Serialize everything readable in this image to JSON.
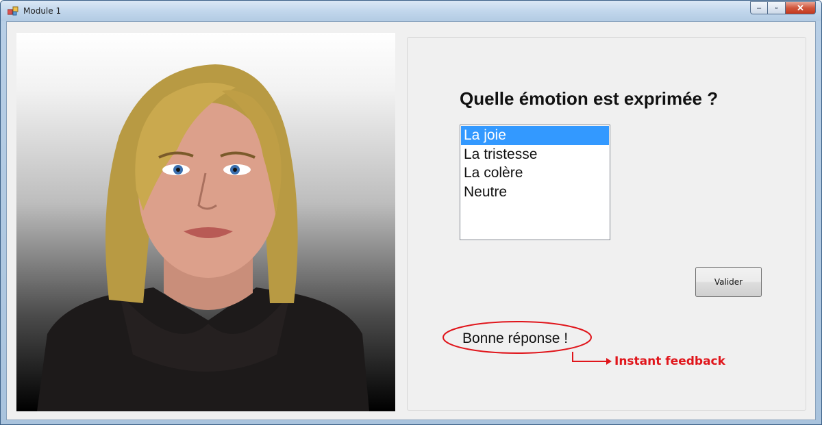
{
  "window": {
    "title": "Module 1",
    "minimize_glyph": "–",
    "maximize_glyph": "▫",
    "close_glyph": "✕"
  },
  "avatar": {
    "icon": "avatar-3d-face",
    "description_visible": false
  },
  "quiz": {
    "question": "Quelle émotion est exprimée ?",
    "options": [
      {
        "label": "La joie",
        "selected": true
      },
      {
        "label": "La tristesse",
        "selected": false
      },
      {
        "label": "La colère",
        "selected": false
      },
      {
        "label": "Neutre",
        "selected": false
      }
    ],
    "submit_label": "Valider",
    "feedback": "Bonne réponse !"
  },
  "annotation": {
    "label": "Instant feedback",
    "color": "#e0151b"
  },
  "colors": {
    "selection": "#3399ff",
    "client_bg": "#f0f0f0"
  }
}
